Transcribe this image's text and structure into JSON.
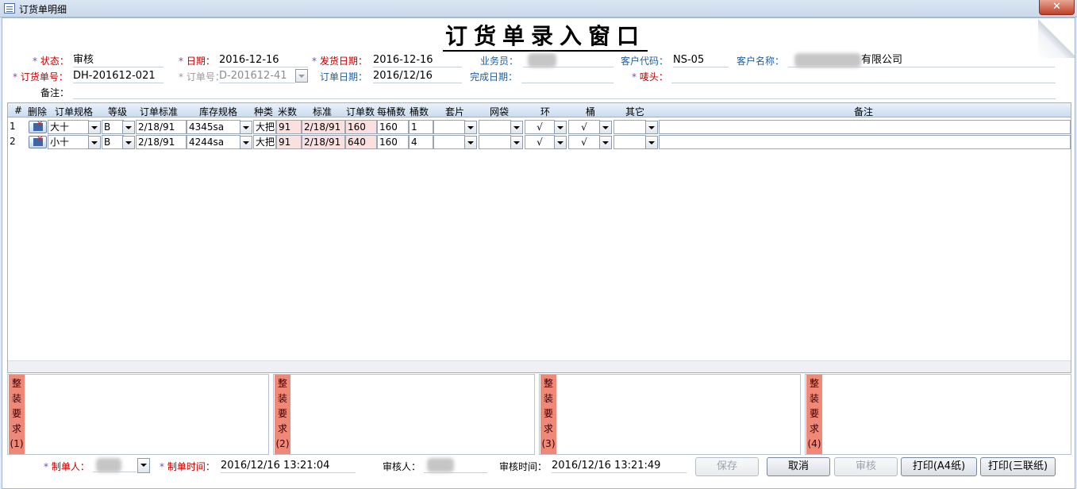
{
  "window": {
    "title": "订货单明细",
    "close_label": "✕"
  },
  "form_title": "订货单录入窗口",
  "header": {
    "status_label": "状态：",
    "status_value": "审核",
    "date_label": "日期：",
    "date_value": "2016-12-16",
    "ship_date_label": "发货日期：",
    "ship_date_value": "2016-12-16",
    "salesman_label": "业务员：",
    "customer_code_label": "客户代码：",
    "customer_code_value": "NS-05",
    "customer_name_label": "客户名称：",
    "customer_name_value": "有限公司",
    "order_no_label": "订货单号：",
    "order_no_value": "DH-201612-021",
    "order_ref_label": "订单号：",
    "order_ref_value": "D-201612-41",
    "order_date_label": "订单日期：",
    "order_date_value": "2016/12/16",
    "finish_date_label": "完成日期：",
    "finish_date_value": "",
    "mark_label": "唛头：",
    "mark_value": "",
    "remark_label": "备注：",
    "remark_value": "",
    "required_star": "*"
  },
  "grid": {
    "columns": [
      "#",
      "删除",
      "订单规格",
      "等级",
      "订单标准",
      "库存规格",
      "种类",
      "米数",
      "标准",
      "订单数",
      "每桶数",
      "桶数",
      "套片",
      "网袋",
      "环",
      "桶",
      "其它",
      "备注"
    ],
    "rows": [
      {
        "no": "1",
        "spec": "大十",
        "grade": "B",
        "order_std": "2/18/91",
        "stock_spec": "4345sa",
        "kind": "大把",
        "meters": "91",
        "std": "2/18/91",
        "order_qty": "160",
        "per_barrel": "160",
        "barrels": "1",
        "sets": "",
        "net_bag": "",
        "ring": "√",
        "barrel": "√",
        "other": "",
        "remark": ""
      },
      {
        "no": "2",
        "spec": "小十",
        "grade": "B",
        "order_std": "2/18/91",
        "stock_spec": "4244sa",
        "kind": "大把",
        "meters": "91",
        "std": "2/18/91",
        "order_qty": "640",
        "per_barrel": "160",
        "barrels": "4",
        "sets": "",
        "net_bag": "",
        "ring": "√",
        "barrel": "√",
        "other": "",
        "remark": ""
      }
    ]
  },
  "packing": [
    {
      "label": "整装要求(1)",
      "c1": "整",
      "c2": "装",
      "c3": "要",
      "c4": "求",
      "c5": "(1)",
      "value": ""
    },
    {
      "label": "整装要求(2)",
      "c1": "整",
      "c2": "装",
      "c3": "要",
      "c4": "求",
      "c5": "(2)",
      "value": ""
    },
    {
      "label": "整装要求(3)",
      "c1": "整",
      "c2": "装",
      "c3": "要",
      "c4": "求",
      "c5": "(3)",
      "value": ""
    },
    {
      "label": "整装要求(4)",
      "c1": "整",
      "c2": "装",
      "c3": "要",
      "c4": "求",
      "c5": "(4)",
      "value": ""
    }
  ],
  "footer": {
    "maker_label": "制单人：",
    "make_time_label": "制单时间：",
    "make_time_value": "2016/12/16 13:21:04",
    "auditor_label": "审核人：",
    "audit_time_label": "审核时间：",
    "audit_time_value": "2016/12/16 13:21:49"
  },
  "buttons": {
    "save": "保存",
    "cancel": "取消",
    "audit": "审核",
    "print_a4": "打印(A4纸)",
    "print_triple": "打印(三联纸)"
  },
  "colors": {
    "required": "#c00000",
    "label": "#1f5ea0",
    "packing_label_bg": "#f08878",
    "pink_cell": "#fbe0e0"
  }
}
